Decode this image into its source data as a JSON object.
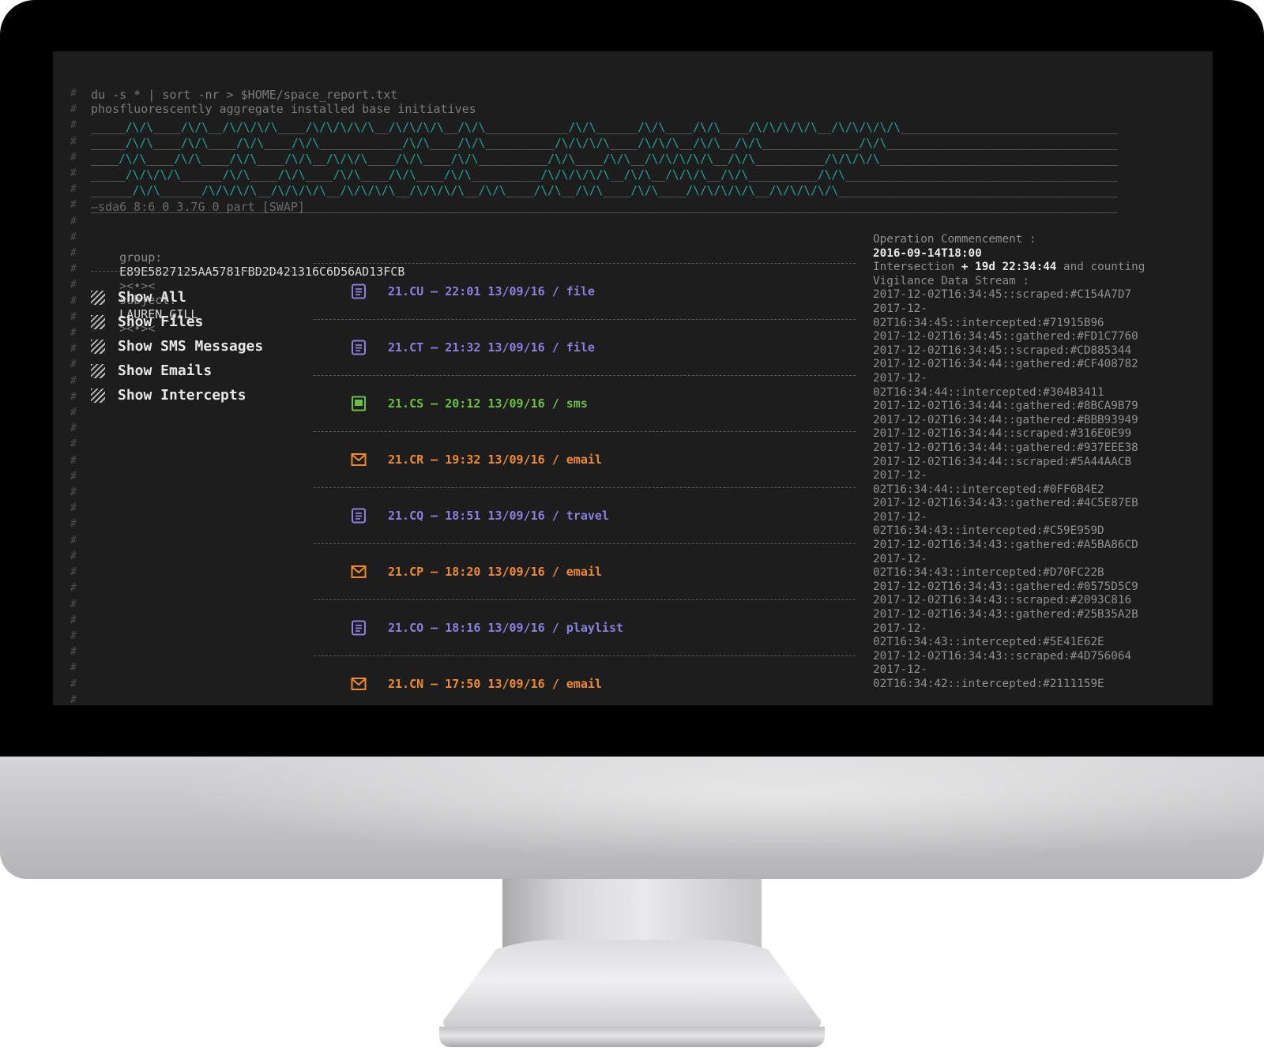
{
  "terminal": {
    "command": "du -s * | sort -nr > $HOME/space_report.txt",
    "tagline": "phosfluorescently aggregate installed base initiatives",
    "ascii_banner": [
      "_____/\\/\\____/\\/\\__/\\/\\/\\/\\____/\\/\\/\\/\\/\\__/\\/\\/\\/\\__/\\/\\____________/\\/\\______/\\/\\____/\\/\\____/\\/\\/\\/\\/\\__/\\/\\/\\/\\/\\______________________________________________________________________",
      "_____/\\/\\____/\\/\\____/\\/\\____/\\/\\____________/\\/\\____/\\/\\__________/\\/\\/\\/\\____/\\/\\/\\__/\\/\\__/\\/\\______________/\\/\\______________________________________________________________________",
      "____/\\/\\____/\\/\\____/\\/\\____/\\/\\__/\\/\\/\\____/\\/\\____/\\/\\__________/\\/\\____/\\/\\__/\\/\\/\\/\\/\\__/\\/\\__________/\\/\\/\\/\\______________________________________________________________________",
      "_____/\\/\\/\\/\\______/\\/\\____/\\/\\____/\\/\\____/\\/\\____/\\/\\__________/\\/\\/\\/\\/\\__/\\/\\__/\\/\\/\\__/\\/\\__________/\\/\\______________________________________________________________________",
      "______/\\/\\______/\\/\\/\\/\\__/\\/\\/\\/\\__/\\/\\/\\/\\__/\\/\\/\\/\\__/\\/\\____/\\/\\__/\\/\\____/\\/\\____/\\/\\/\\/\\/\\__/\\/\\/\\/\\/\\______________________________________________________________________",
      "__________________________________________________________________________________________________________________________________________________________________________"
    ],
    "disk_line": "—sda6 8:6 0 3.7G 0 part [SWAP]",
    "gutter_char": "#"
  },
  "ident": {
    "group_label": "group:",
    "group_value": "E89E5827125AA5781FBD2D421316C6D56AD13FCB",
    "separator": "><•><",
    "subject_label": "subject:",
    "subject_value": "LAUREN_GILL"
  },
  "menu": [
    {
      "label": "Show All"
    },
    {
      "label": "Show Files"
    },
    {
      "label": "Show SMS Messages"
    },
    {
      "label": "Show Emails"
    },
    {
      "label": "Show Intercepts"
    }
  ],
  "feed": [
    {
      "text": "21.CU – 22:01 13/09/16 / file",
      "icon": "document-icon",
      "color": "#8b7fe0"
    },
    {
      "text": "21.CT – 21:32 13/09/16 / file",
      "icon": "document-icon",
      "color": "#8b7fe0"
    },
    {
      "text": "21.CS – 20:12 13/09/16 / sms",
      "icon": "sms-icon",
      "color": "#6cc040"
    },
    {
      "text": "21.CR – 19:32 13/09/16 / email",
      "icon": "envelope-icon",
      "color": "#f08a2a"
    },
    {
      "text": "21.CQ – 18:51 13/09/16 / travel",
      "icon": "document-icon",
      "color": "#8b7fe0"
    },
    {
      "text": "21.CP – 18:20 13/09/16 / email",
      "icon": "envelope-icon",
      "color": "#f08a2a"
    },
    {
      "text": "21.CO – 18:16 13/09/16 / playlist",
      "icon": "document-icon",
      "color": "#8b7fe0"
    },
    {
      "text": "21.CN – 17:50 13/09/16 / email",
      "icon": "envelope-icon",
      "color": "#f08a2a"
    }
  ],
  "side": {
    "commencement_label": "Operation Commencement :",
    "commencement_value": "2016-09-14T18:00",
    "intersection_label": "Intersection",
    "intersection_value": "+ 19d 22:34:44",
    "intersection_suffix": "and counting",
    "stream_label": "Vigilance Data Stream :",
    "log": [
      "2017-12-02T16:34:45::scraped:#C154A7D7",
      "2017-12-\n02T16:34:45::intercepted:#71915B96",
      "2017-12-02T16:34:45::gathered:#FD1C7760",
      "2017-12-02T16:34:45::scraped:#CD885344",
      "2017-12-02T16:34:44::gathered:#CF408782",
      "2017-12-\n02T16:34:44::intercepted:#304B3411",
      "2017-12-02T16:34:44::gathered:#8BCA9B79",
      "2017-12-02T16:34:44::gathered:#BBB93949",
      "2017-12-02T16:34:44::scraped:#316E0E99",
      "2017-12-02T16:34:44::gathered:#937EEE38",
      "2017-12-02T16:34:44::scraped:#5A44AACB",
      "2017-12-\n02T16:34:44::intercepted:#0FF6B4E2",
      "2017-12-02T16:34:43::gathered:#4C5E87EB",
      "2017-12-\n02T16:34:43::intercepted:#C59E959D",
      "2017-12-02T16:34:43::gathered:#A5BA86CD",
      "2017-12-\n02T16:34:43::intercepted:#D70FC22B",
      "2017-12-02T16:34:43::gathered:#0575D5C9",
      "2017-12-02T16:34:43::scraped:#2093C816",
      "2017-12-02T16:34:43::gathered:#25B35A2B",
      "2017-12-\n02T16:34:43::intercepted:#5E41E62E",
      "2017-12-02T16:34:43::scraped:#4D756064",
      "2017-12-\n02T16:34:42::intercepted:#2111159E"
    ]
  },
  "colors": {
    "background": "#1d1d1d",
    "ascii_peak": "#1aa39a",
    "file": "#8b7fe0",
    "sms": "#6cc040",
    "email": "#f08a2a"
  }
}
